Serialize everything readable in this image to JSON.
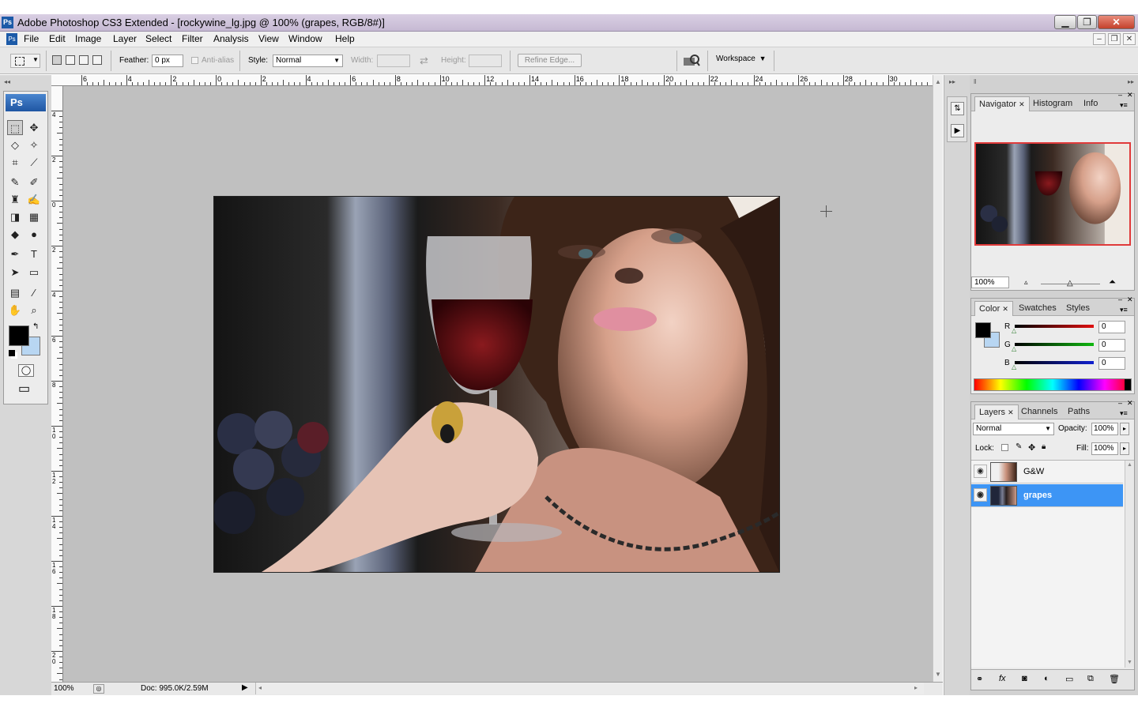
{
  "window": {
    "app_icon": "Ps",
    "title": "Adobe Photoshop CS3 Extended - [rockywine_lg.jpg @ 100% (grapes, RGB/8#)]",
    "controls": {
      "minimize": "▁",
      "restore": "❐",
      "close": "✕"
    }
  },
  "menubar": {
    "icon": "Ps",
    "items": [
      "File",
      "Edit",
      "Image",
      "Layer",
      "Select",
      "Filter",
      "Analysis",
      "View",
      "Window",
      "Help"
    ],
    "doc_controls": {
      "minimize": "–",
      "restore": "❐",
      "close": "✕"
    }
  },
  "options": {
    "feather_label": "Feather:",
    "feather_value": "0 px",
    "antialias_label": "Anti-alias",
    "style_label": "Style:",
    "style_value": "Normal",
    "width_label": "Width:",
    "height_label": "Height:",
    "swap_icon": "⇄",
    "refine_edge": "Refine Edge...",
    "workspace": "Workspace"
  },
  "toolbox": {
    "title": "Ps",
    "tools": [
      [
        "marquee-icon",
        "⬚",
        "move-icon",
        "✥"
      ],
      [
        "lasso-icon",
        "◇",
        "magic-wand-icon",
        "✧"
      ],
      [
        "crop-icon",
        "⌗",
        "slice-icon",
        "⟋"
      ],
      [
        "healing-brush-icon",
        "✎",
        "brush-icon",
        "✐"
      ],
      [
        "clone-stamp-icon",
        "♜",
        "history-brush-icon",
        "✍"
      ],
      [
        "eraser-icon",
        "◨",
        "gradient-icon",
        "▦"
      ],
      [
        "blur-icon",
        "◆",
        "dodge-icon",
        "●"
      ],
      [
        "pen-icon",
        "✒",
        "type-icon",
        "T"
      ],
      [
        "path-select-icon",
        "➤",
        "shape-icon",
        "▭"
      ],
      [
        "notes-icon",
        "▤",
        "eyedropper-icon",
        "⁄"
      ],
      [
        "hand-icon",
        "✋",
        "zoom-icon",
        "⌕"
      ]
    ],
    "quickmask_icon": "◯",
    "screenmode_icon": "▭"
  },
  "ruler_top": [
    "6",
    "4",
    "2",
    "0",
    "2",
    "4",
    "6",
    "8",
    "10",
    "12",
    "14",
    "16",
    "18",
    "20",
    "22",
    "24",
    "26",
    "28",
    "30"
  ],
  "ruler_left": [
    "4",
    "2",
    "0",
    "2",
    "4",
    "6",
    "8",
    "10",
    "12",
    "14",
    "16",
    "18",
    "20"
  ],
  "status": {
    "zoom": "100%",
    "doc": "Doc: 995.0K/2.59M"
  },
  "navigator": {
    "tabs": [
      "Navigator",
      "Histogram",
      "Info"
    ],
    "zoom": "100%"
  },
  "color": {
    "tabs": [
      "Color",
      "Swatches",
      "Styles"
    ],
    "channels": [
      {
        "label": "R",
        "value": "0",
        "color": "#e01010"
      },
      {
        "label": "G",
        "value": "0",
        "color": "#10b810"
      },
      {
        "label": "B",
        "value": "0",
        "color": "#1020d0"
      }
    ]
  },
  "layers": {
    "tabs": [
      "Layers",
      "Channels",
      "Paths"
    ],
    "blend_mode": "Normal",
    "opacity_label": "Opacity:",
    "opacity_value": "100%",
    "lock_label": "Lock:",
    "fill_label": "Fill:",
    "fill_value": "100%",
    "items": [
      {
        "name": "G&W",
        "selected": false
      },
      {
        "name": "grapes",
        "selected": true
      }
    ]
  },
  "colors": {
    "selection": "#3d95f5",
    "foreground": "#000000",
    "background": "#b8d6f2"
  }
}
